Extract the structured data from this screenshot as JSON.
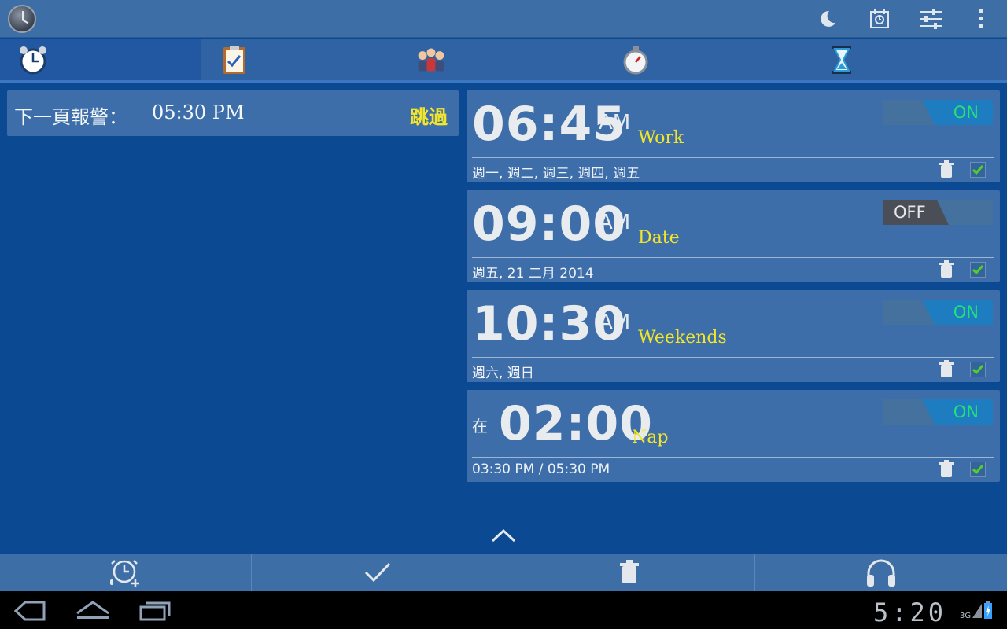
{
  "actionbar": {
    "app_icon": "alarm-clock-app-icon",
    "actions": [
      "night-mode-moon-icon",
      "calendar-icon",
      "settings-sliders-icon",
      "overflow-menu-icon"
    ]
  },
  "tabs": [
    {
      "icon": "alarm-clock-tab-icon",
      "active": true
    },
    {
      "icon": "clipboard-checklist-tab-icon",
      "active": false
    },
    {
      "icon": "people-group-tab-icon",
      "active": false
    },
    {
      "icon": "stopwatch-tab-icon",
      "active": false
    },
    {
      "icon": "hourglass-tab-icon",
      "active": false
    }
  ],
  "next_alarm": {
    "label": "下一頁報警：",
    "time": "05:30 PM",
    "skip_label": "跳過"
  },
  "alarms": [
    {
      "time": "06:45",
      "ampm": "AM",
      "label": "Work",
      "days": "週一, 週二, 週三, 週四, 週五",
      "state": "ON",
      "enabled": true
    },
    {
      "time": "09:00",
      "ampm": "AM",
      "label": "Date",
      "days": "週五, 21 二月 2014",
      "state": "OFF",
      "enabled": false
    },
    {
      "time": "10:30",
      "ampm": "AM",
      "label": "Weekends",
      "days": "週六, 週日",
      "state": "ON",
      "enabled": true
    },
    {
      "prefix": "在",
      "time": "02:00",
      "label": "Nap",
      "days": "03:30 PM / 05:30 PM",
      "state": "ON",
      "enabled": true
    }
  ],
  "bottombar": {
    "actions": [
      "add-alarm-voice-icon",
      "checkmark-icon",
      "trash-icon",
      "headphones-icon"
    ]
  },
  "system": {
    "clock": "5:20",
    "network": "3G"
  },
  "colors": {
    "accent_yellow": "#f3e62a",
    "toggle_on_text": "#22e07a",
    "background": "#0b4a93"
  }
}
